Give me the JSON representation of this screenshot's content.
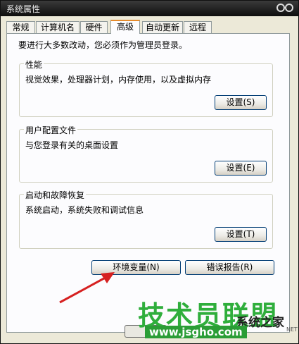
{
  "window": {
    "title": "系统属性"
  },
  "tabs": [
    {
      "label": "常规",
      "active": false
    },
    {
      "label": "计算机名",
      "active": false
    },
    {
      "label": "硬件",
      "active": false
    },
    {
      "label": "高级",
      "active": true
    },
    {
      "label": "自动更新",
      "active": false
    },
    {
      "label": "远程",
      "active": false
    }
  ],
  "intro": "要进行大多数改动，您必须作为管理员登录。",
  "groups": {
    "performance": {
      "title": "性能",
      "desc": "视觉效果，处理器计划，内存使用，以及虚拟内存",
      "button": "设置(S)"
    },
    "profiles": {
      "title": "用户配置文件",
      "desc": "与您登录有关的桌面设置",
      "button": "设置(E)"
    },
    "startup": {
      "title": "启动和故障恢复",
      "desc": "系统启动，系统失败和调试信息",
      "button": "设置(T)"
    }
  },
  "buttons": {
    "env": "环境变量(N)",
    "error": "错误报告(R)"
  },
  "watermark": {
    "main": "技术员联盟",
    "url": "www.jsgho.com",
    "dark": "系统之家",
    "net": "NET"
  },
  "colors": {
    "tab_active_accent": "#e68b2c",
    "arrow": "#d62020",
    "watermark_green": "#2fae3c"
  }
}
